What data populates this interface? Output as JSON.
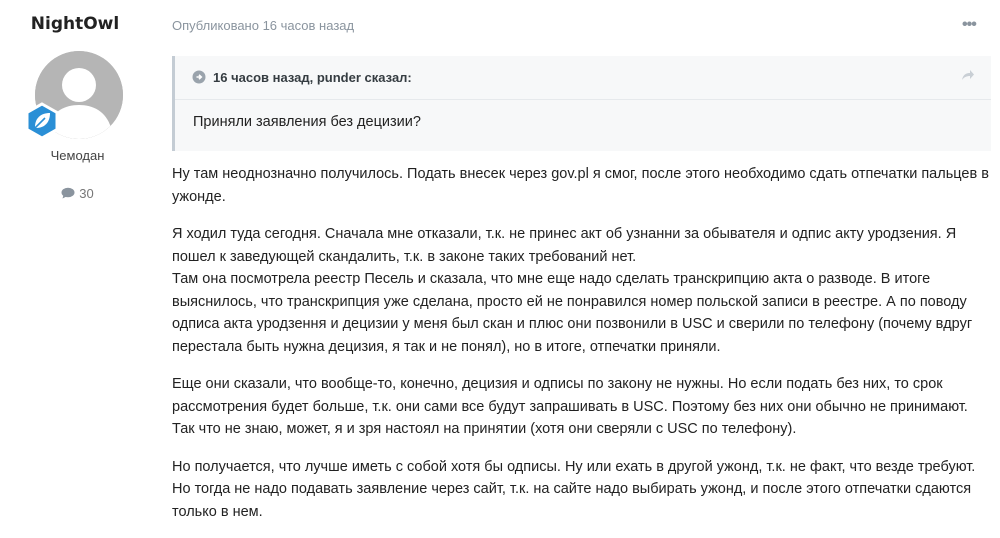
{
  "author": {
    "name": "NightOwl",
    "rank": "Чемодан",
    "post_count": "30",
    "post_icon": "comment-icon",
    "badge_icon": "leaf-badge-icon",
    "avatar_color": "#b5b5b5"
  },
  "post": {
    "meta": "Опубликовано 16 часов назад",
    "menu_icon": "ellipsis-icon",
    "quote": {
      "header": "16 часов назад, punder сказал:",
      "text": "Приняли заявления без децизии?"
    },
    "paragraphs": [
      [
        "Ну там неоднозначно получилось. Подать внесек через gov.pl я смог, после этого необходимо сдать отпечатки пальцев в ужонде."
      ],
      [
        "Я ходил туда сегодня. Сначала мне отказали, т.к. не принес акт об узнанни за обывателя и одпис акту уродзения. Я пошел к заведующей скандалить, т.к. в законе таких требований нет.",
        "Там она посмотрела реестр Песель и сказала, что мне еще надо сделать транскрипцию акта о разводе. В итоге выяснилось, что транскрипция уже сделана, просто ей не понравился номер польской записи в реестре. А по поводу одписа акта уродзення и децизии у меня был скан и плюс они позвонили в USC и сверили по телефону (почему вдруг перестала быть нужна децизия, я так и не понял), но в итоге, отпечатки приняли."
      ],
      [
        "Еще они сказали, что вообще-то, конечно, децизия и одписы по закону не нужны. Но если подать без них, то срок рассмотрения будет больше, т.к. они сами все будут запрашивать в USC. Поэтому без них они обычно не принимают. Так что не знаю, может, я и зря настоял на принятии (хотя они сверяли с USC по телефону)."
      ],
      [
        "Но получается, что лучше иметь с собой хотя бы одписы. Ну или ехать в другой ужонд, т.к. не факт, что везде требуют. Но тогда не надо подавать заявление через сайт, т.к. на сайте надо выбирать ужонд, и после этого отпечатки сдаются только в нем."
      ]
    ]
  },
  "colors": {
    "meta": "#8a949e",
    "badge": "#2a8fd6",
    "quote_bg": "#f7f8f9"
  }
}
